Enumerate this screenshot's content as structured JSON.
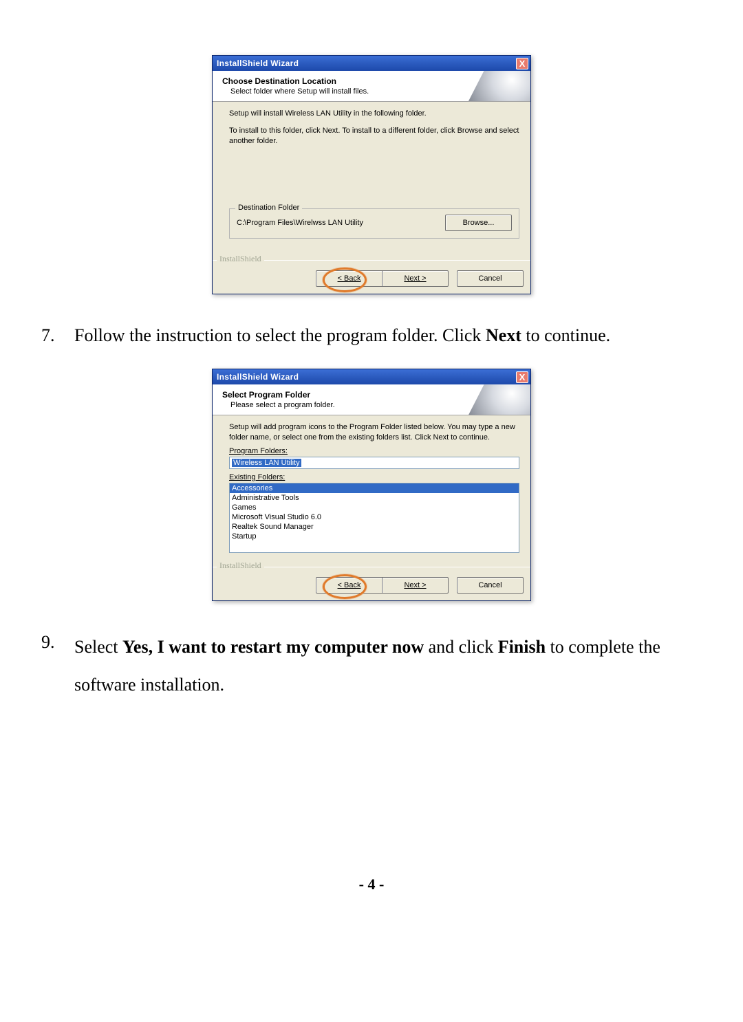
{
  "wizard1": {
    "title": "InstallShield Wizard",
    "close_glyph": "X",
    "header_title": "Choose Destination Location",
    "header_sub": "Select folder where Setup will install files.",
    "line1": "Setup will install Wireless LAN Utility in the following folder.",
    "line2": "To install to this folder, click Next. To install to a different folder, click Browse and select another folder.",
    "group_legend": "Destination Folder",
    "path": "C:\\Program Files\\Wirelwss LAN Utility",
    "browse": "Browse...",
    "brand": "InstallShield",
    "back": "< Back",
    "next": "Next >",
    "cancel": "Cancel"
  },
  "step7": {
    "num": "7.",
    "pre": "Follow the instruction to select the program folder. Click ",
    "bold": "Next",
    "post": " to continue."
  },
  "wizard2": {
    "title": "InstallShield Wizard",
    "close_glyph": "X",
    "header_title": "Select Program Folder",
    "header_sub": "Please select a program folder.",
    "intro": "Setup will add program icons to the Program Folder listed below.  You may type a new folder name, or select one from the existing folders list.  Click Next to continue.",
    "program_folders_label": "Program Folders:",
    "program_folders_value": "Wireless LAN Utility",
    "existing_label": "Existing Folders:",
    "existing": [
      "Accessories",
      "Administrative Tools",
      "Games",
      "Microsoft Visual Studio 6.0",
      "Realtek Sound Manager",
      "Startup"
    ],
    "brand": "InstallShield",
    "back": "< Back",
    "next": "Next >",
    "cancel": "Cancel"
  },
  "step9": {
    "num": "9.",
    "pre": "Select ",
    "bold1": "Yes, I want to restart my computer now",
    "mid": " and click ",
    "bold2": "Finish",
    "post": " to complete the software installation."
  },
  "pagenum": "- 4 -"
}
